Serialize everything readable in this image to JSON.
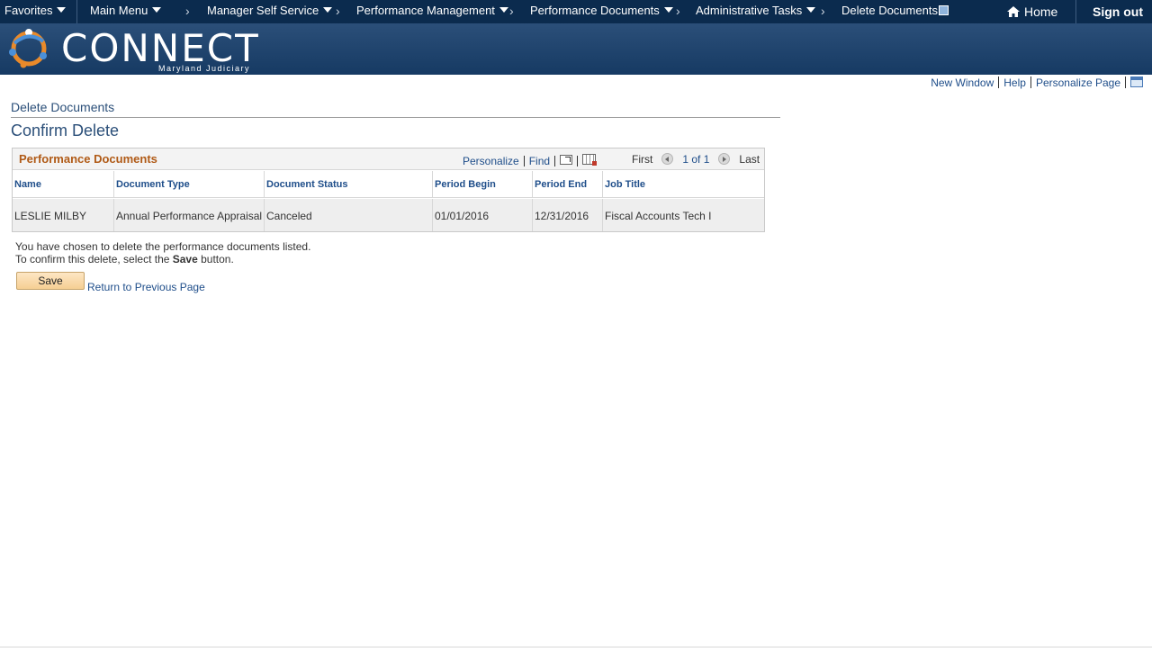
{
  "topnav": {
    "items": [
      {
        "label": "Favorites"
      },
      {
        "label": "Main Menu"
      },
      {
        "label": "Manager Self Service"
      },
      {
        "label": "Performance Management"
      },
      {
        "label": "Performance Documents"
      },
      {
        "label": "Administrative Tasks"
      },
      {
        "label": "Delete Documents"
      }
    ],
    "home_label": "Home",
    "signout_label": "Sign out"
  },
  "banner": {
    "logo_text": "CONNECT",
    "logo_sub": "Maryland Judiciary"
  },
  "pagelinks": {
    "new_window": "New Window",
    "help": "Help",
    "personalize_page": "Personalize Page"
  },
  "page": {
    "crumb_title": "Delete Documents",
    "title": "Confirm Delete"
  },
  "grid": {
    "title": "Performance Documents",
    "personalize": "Personalize",
    "find": "Find",
    "first": "First",
    "count": "1 of 1",
    "last": "Last",
    "columns": [
      "Name",
      "Document Type",
      "Document Status",
      "Period Begin",
      "Period End",
      "Job Title"
    ],
    "rows": [
      [
        "LESLIE MILBY",
        "Annual Performance Appraisal",
        "Canceled",
        "01/01/2016",
        "12/31/2016",
        "Fiscal Accounts Tech I"
      ]
    ]
  },
  "message": {
    "line1": "You have chosen to delete the performance documents listed.",
    "line2_pre": "To confirm this delete, select the ",
    "line2_bold": "Save",
    "line2_post": " button."
  },
  "actions": {
    "save": "Save",
    "return": "Return to Previous Page"
  },
  "colors": {
    "nav_bg": "#0b2b4e",
    "banner_bg": "#1f4570",
    "link": "#1f4e8a",
    "grid_title": "#b05a16",
    "save_btn": "#f6cf93"
  }
}
